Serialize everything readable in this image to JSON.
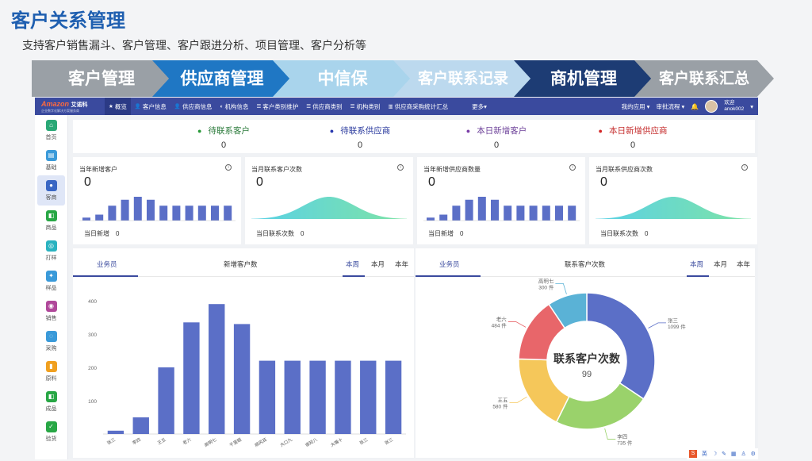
{
  "slide": {
    "title": "客户关系管理",
    "subtitle": "支持客户销售漏斗、客户管理、客户跟进分析、项目管理、客户分析等"
  },
  "banner": [
    {
      "label": "客户管理",
      "color": "#9aa0a6"
    },
    {
      "label": "供应商管理",
      "color": "#1f77c4"
    },
    {
      "label": "中信保",
      "color": "#a9d4ec"
    },
    {
      "label": "客户联系记录",
      "color": "#bcd9ee"
    },
    {
      "label": "商机管理",
      "color": "#1d3c74"
    },
    {
      "label": "客户联系汇总",
      "color": "#9aa0a6"
    }
  ],
  "app": {
    "logo_main": "Amazon",
    "logo_brand": "艾诺科",
    "logo_sub": "企业数字化解决方案服务商",
    "nav": [
      "概览",
      "客户信息",
      "供应商信息",
      "机构信息",
      "客户类别维护",
      "供应商类别",
      "机构类别",
      "供应商采购统计汇总",
      "更多"
    ],
    "nav_icons": [
      "★",
      "👤",
      "👤",
      "◐",
      "☰",
      "☰",
      "☰",
      "▥",
      ""
    ],
    "nav_right": {
      "my_apps": "我的应用",
      "approval": "审批流程",
      "bell": "🔔",
      "welcome": "欢迎",
      "user": "anok002"
    },
    "sidebar": [
      {
        "label": "首页",
        "color": "#2aa876",
        "icon": "⌂"
      },
      {
        "label": "基础",
        "color": "#3a9ad9",
        "icon": "▤"
      },
      {
        "label": "客商",
        "color": "#3a67c4",
        "icon": "●"
      },
      {
        "label": "商品",
        "color": "#28a745",
        "icon": "◧"
      },
      {
        "label": "打样",
        "color": "#2bb3c0",
        "icon": "◎"
      },
      {
        "label": "样品",
        "color": "#3a9ad9",
        "icon": "✦"
      },
      {
        "label": "销售",
        "color": "#b0489a",
        "icon": "◉"
      },
      {
        "label": "采购",
        "color": "#3a9ad9",
        "icon": "◌"
      },
      {
        "label": "原料",
        "color": "#f0a020",
        "icon": "▮"
      },
      {
        "label": "成品",
        "color": "#28a745",
        "icon": "◧"
      },
      {
        "label": "验货",
        "color": "#28a745",
        "icon": "✓"
      }
    ],
    "summary": [
      {
        "label": "待联系客户",
        "value": "0",
        "dot_color": "#2a9a3a",
        "label_color": "#2a7a3a"
      },
      {
        "label": "待联系供应商",
        "value": "0",
        "dot_color": "#2a3ab0",
        "label_color": "#2a3a9e"
      },
      {
        "label": "本日新增客户",
        "value": "0",
        "dot_color": "#7b3fa8",
        "label_color": "#6b3f98"
      },
      {
        "label": "本日新增供应商",
        "value": "0",
        "dot_color": "#d42a2a",
        "label_color": "#c42a2a"
      }
    ],
    "cards": [
      {
        "title": "当年新增客户",
        "value": "0",
        "foot_label": "当日新增",
        "foot_value": "0",
        "kind": "bar",
        "info": "i"
      },
      {
        "title": "当月联系客户次数",
        "value": "0",
        "foot_label": "当日联系次数",
        "foot_value": "0",
        "kind": "area",
        "info": "i"
      },
      {
        "title": "当年新增供应商数量",
        "value": "0",
        "foot_label": "当日新增",
        "foot_value": "0",
        "kind": "bar",
        "info": "i"
      },
      {
        "title": "当月联系供应商次数",
        "value": "0",
        "foot_label": "当日联系次数",
        "foot_value": "0",
        "kind": "area",
        "info": "i"
      }
    ],
    "left_panel": {
      "tab1": "业务员",
      "center": "新增客户数",
      "periods": [
        "本周",
        "本月",
        "本年"
      ]
    },
    "right_panel": {
      "tab1": "业务员",
      "center": "联系客户次数",
      "periods": [
        "本周",
        "本月",
        "本年"
      ]
    },
    "tools": [
      "S",
      "英",
      "☽",
      "✎",
      "▦",
      "♙",
      "⚙"
    ]
  },
  "chart_data": [
    {
      "type": "bar",
      "title": "新增客户数",
      "categories": [
        "张三",
        "李四",
        "王五",
        "老六",
        "高明七",
        "千里眼",
        "顺风耳",
        "大口九",
        "谁知八",
        "大嘴十",
        "张三",
        "张三"
      ],
      "values": [
        10,
        50,
        200,
        335,
        390,
        330,
        220,
        220,
        220,
        220,
        220,
        220
      ],
      "ylim": [
        0,
        400
      ],
      "yticks": [
        400,
        300,
        200,
        100
      ],
      "color": "#5b6fc7"
    },
    {
      "type": "pie",
      "title": "联系客户次数",
      "center_value": "99",
      "slices": [
        {
          "name": "张三",
          "value": 1099,
          "label": "1099 件",
          "color": "#5b6fc7"
        },
        {
          "name": "李四",
          "value": 735,
          "label": "735 件",
          "color": "#9ad26b"
        },
        {
          "name": "王五",
          "value": 580,
          "label": "580 件",
          "color": "#f5c75a"
        },
        {
          "name": "老六",
          "value": 484,
          "label": "484 件",
          "color": "#e8666a"
        },
        {
          "name": "高明七",
          "value": 300,
          "label": "300 件",
          "color": "#5ab2d6"
        }
      ]
    },
    {
      "type": "bar",
      "title": "当年新增客户",
      "values": [
        1,
        2,
        5,
        7,
        8,
        7,
        5,
        5,
        5,
        5,
        5,
        5
      ],
      "color": "#5b6fc7"
    },
    {
      "type": "area",
      "title": "当月联系客户次数",
      "color": "#46d6c0"
    }
  ]
}
